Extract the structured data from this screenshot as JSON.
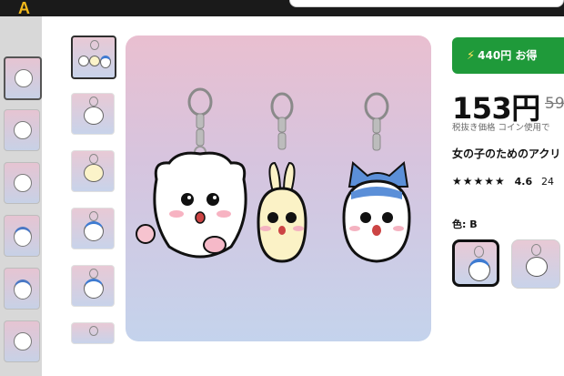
{
  "site": {
    "logo_text": "A"
  },
  "gallery": {
    "thumbnails": [
      {
        "label": "3 keychains",
        "kind": "group"
      },
      {
        "label": "bear keychain",
        "kind": "bear"
      },
      {
        "label": "rabbit keychain",
        "kind": "rabbit"
      },
      {
        "label": "cat keychain blue",
        "kind": "cat"
      },
      {
        "label": "cat keychain",
        "kind": "cat"
      },
      {
        "label": "bear keychain",
        "kind": "bear"
      }
    ]
  },
  "offer": {
    "discount_label": "440円 お得",
    "price": "153円",
    "old_price": "59",
    "tax_note": "税抜き価格 コイン使用で",
    "title": "女の子のためのアクリ",
    "rating_stars": "★★★★★",
    "rating_value": "4.6",
    "rating_count": "24",
    "color_label": "色: B"
  },
  "colors": {
    "accent_green": "#1f9a3a",
    "icon_blue": "#3e7bd1"
  }
}
